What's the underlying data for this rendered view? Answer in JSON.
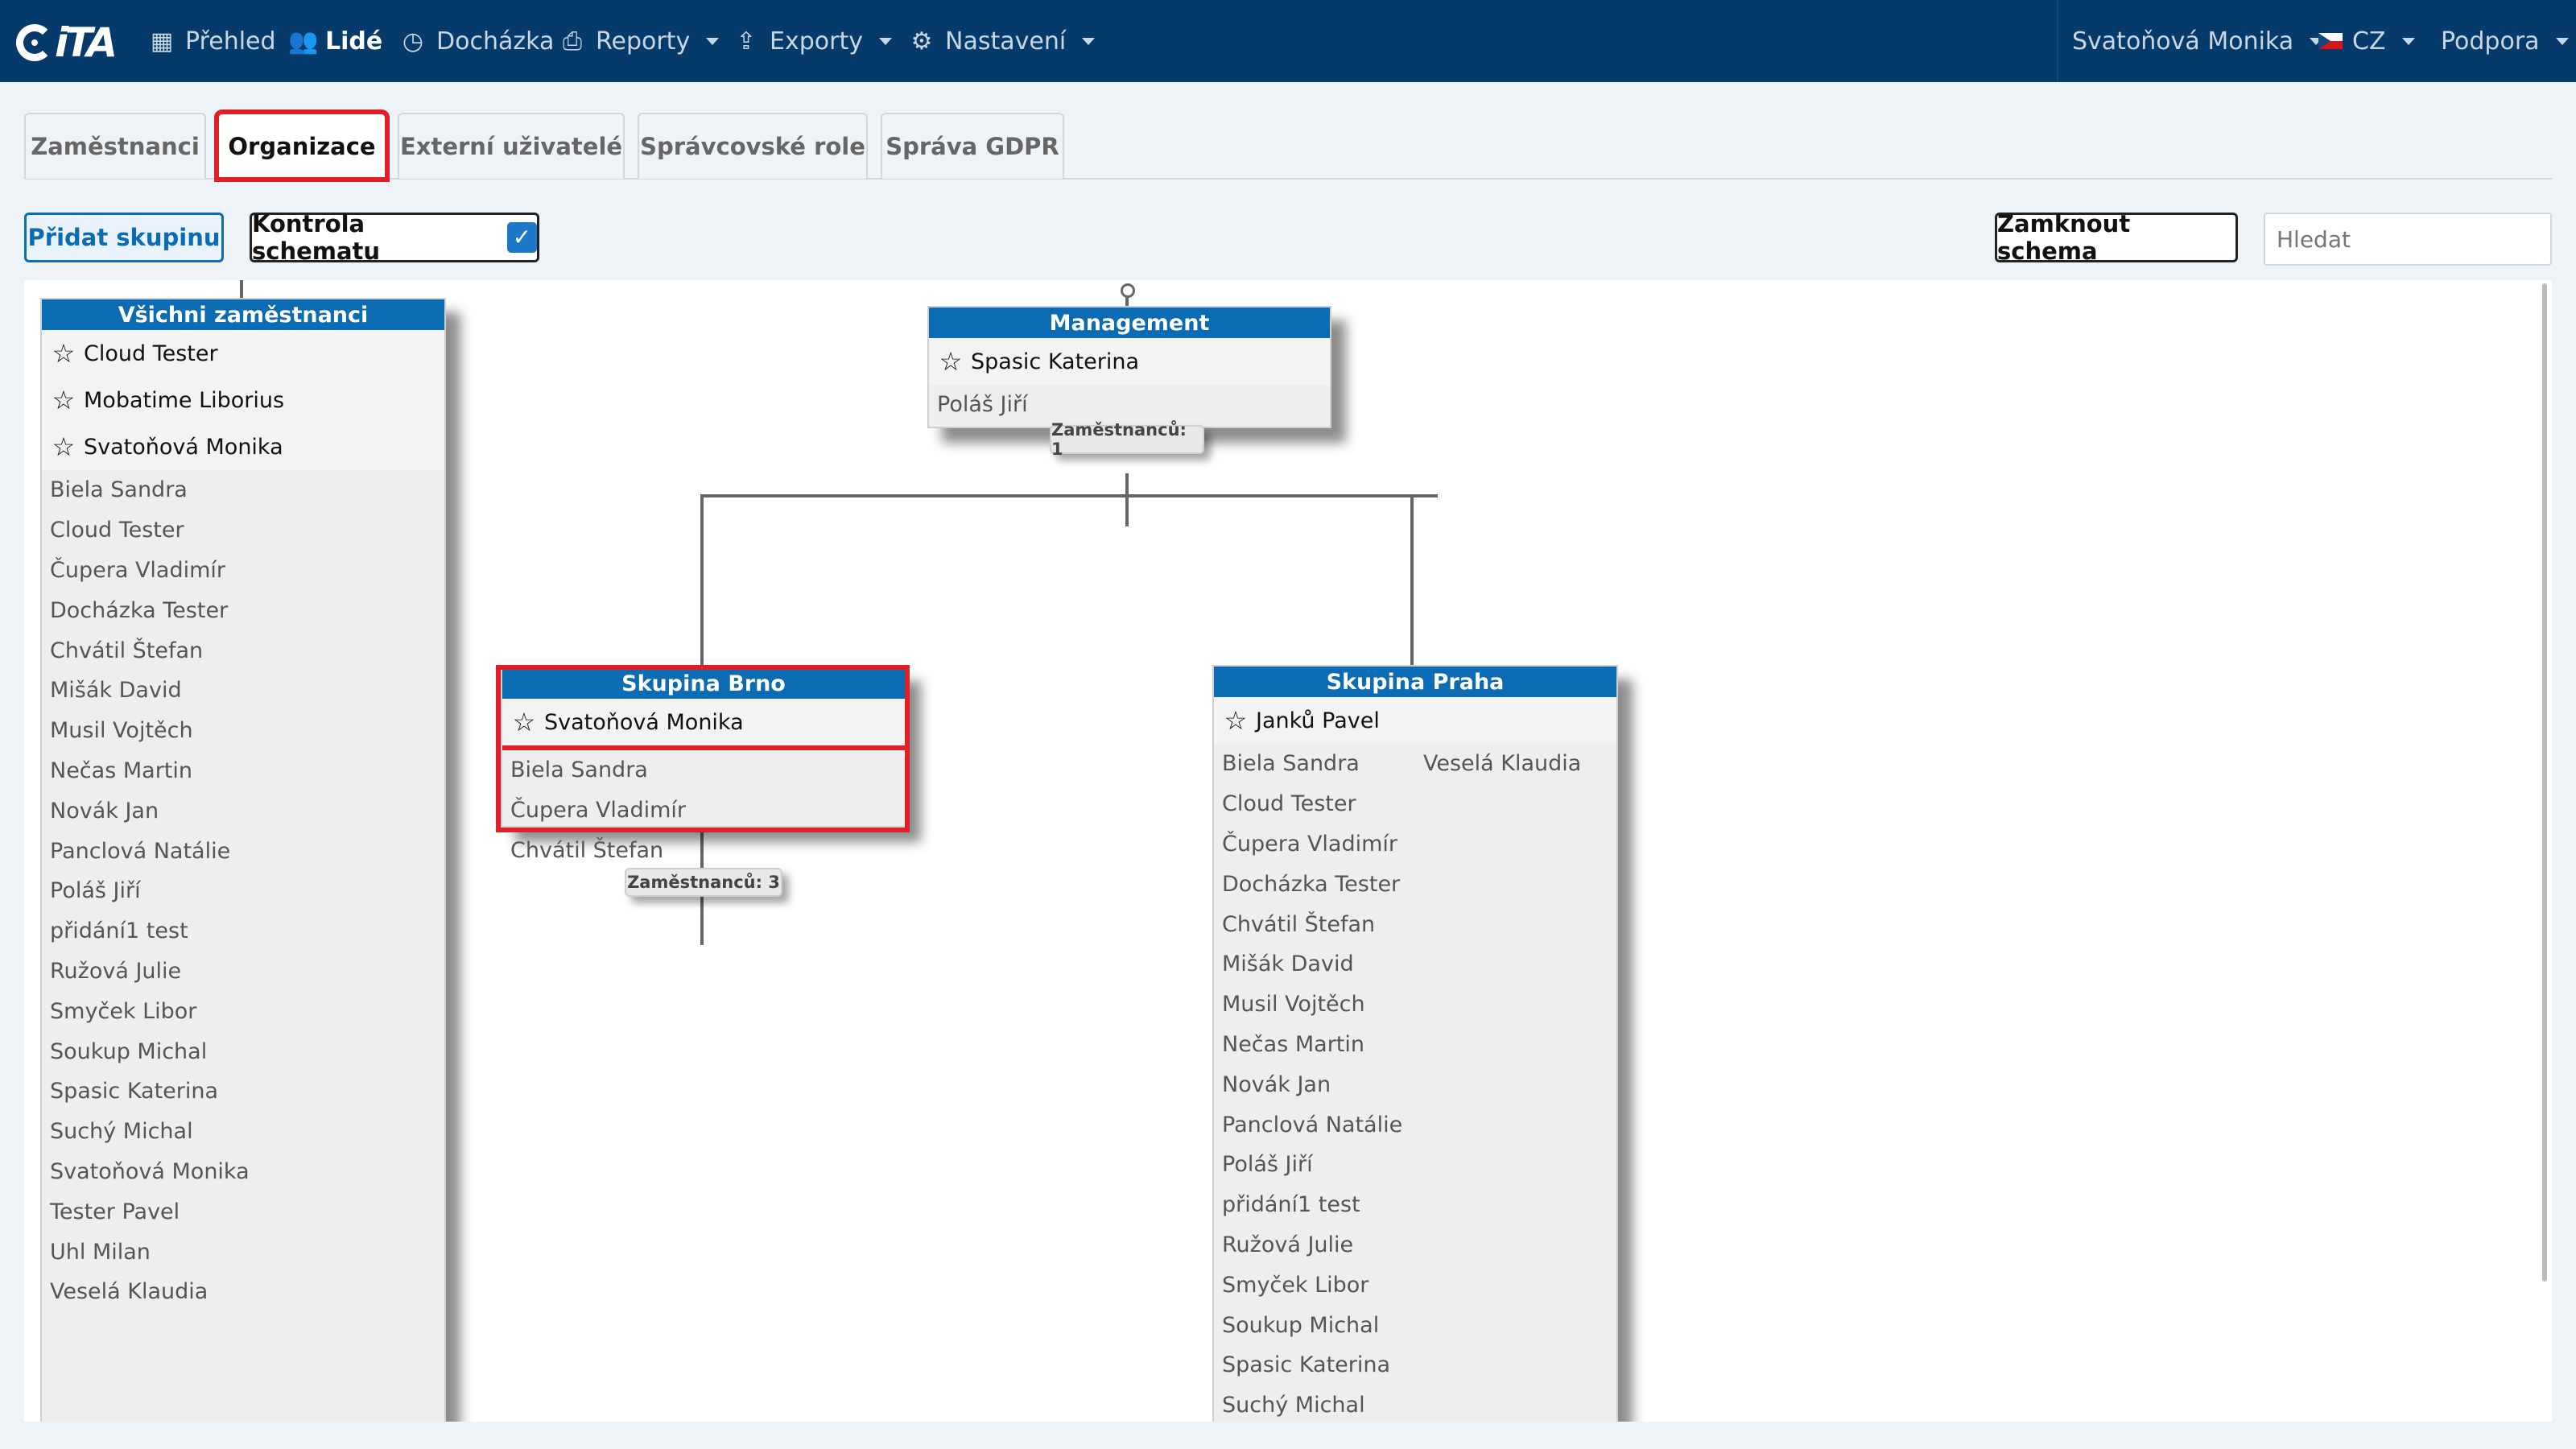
{
  "app": {
    "logo_text": "iTA"
  },
  "nav": {
    "items": [
      {
        "label": "Přehled",
        "icon": "grid-icon"
      },
      {
        "label": "Lidé",
        "icon": "users-icon"
      },
      {
        "label": "Docházka",
        "icon": "clock-icon"
      },
      {
        "label": "Reporty",
        "icon": "printer-icon"
      },
      {
        "label": "Exporty",
        "icon": "export-icon"
      },
      {
        "label": "Nastavení",
        "icon": "gear-icon"
      }
    ],
    "user": "Svatoňová Monika",
    "language": "CZ",
    "support": "Podpora"
  },
  "tabs": [
    {
      "label": "Zaměstnanci"
    },
    {
      "label": "Organizace"
    },
    {
      "label": "Externí uživatelé"
    },
    {
      "label": "Správcovské role"
    },
    {
      "label": "Správa GDPR"
    }
  ],
  "toolbar": {
    "add_group": "Přidat skupinu",
    "schema_check": "Kontrola schematu",
    "schema_check_mark": "✓",
    "lock_schema": "Zamknout schema",
    "search_placeholder": "Hledat"
  },
  "groups": {
    "all": {
      "title": "Všichni zaměstnanci",
      "leaders": [
        "Cloud Tester",
        "Mobatime Liborius",
        "Svatoňová Monika"
      ],
      "members": [
        "Biela Sandra",
        "Cloud Tester",
        "Čupera Vladimír",
        "Docházka Tester",
        "Chvátil Štefan",
        "Mišák David",
        "Musil Vojtěch",
        "Nečas Martin",
        "Novák Jan",
        "Panclová Natálie",
        "Poláš Jiří",
        "přidání1 test",
        "Ružová Julie",
        "Smyček Libor",
        "Soukup Michal",
        "Spasic Katerina",
        "Suchý Michal",
        "Svatoňová Monika",
        "Tester Pavel",
        "Uhl Milan",
        "Veselá Klaudia"
      ]
    },
    "management": {
      "title": "Management",
      "leader": "Spasic Katerina",
      "members": [
        "Poláš Jiří"
      ],
      "count": "Zaměstnanců: 1"
    },
    "brno": {
      "title": "Skupina Brno",
      "leader": "Svatoňová Monika",
      "members": [
        "Biela Sandra",
        "Čupera Vladimír",
        "Chvátil Štefan"
      ],
      "count": "Zaměstnanců: 3"
    },
    "praha": {
      "title": "Skupina Praha",
      "leader": "Janků Pavel",
      "members": [
        "Biela Sandra",
        "Cloud Tester",
        "Čupera Vladimír",
        "Docházka Tester",
        "Chvátil Štefan",
        "Mišák David",
        "Musil Vojtěch",
        "Nečas Martin",
        "Novák Jan",
        "Panclová Natálie",
        "Poláš Jiří",
        "přidání1 test",
        "Ružová Julie",
        "Smyček Libor",
        "Soukup Michal",
        "Spasic Katerina",
        "Suchý Michal"
      ],
      "members_col2": [
        "Veselá Klaudia"
      ]
    }
  },
  "colors": {
    "navbar": "#053a6b",
    "group_header": "#0b6bb3",
    "highlight": "#e02028"
  }
}
